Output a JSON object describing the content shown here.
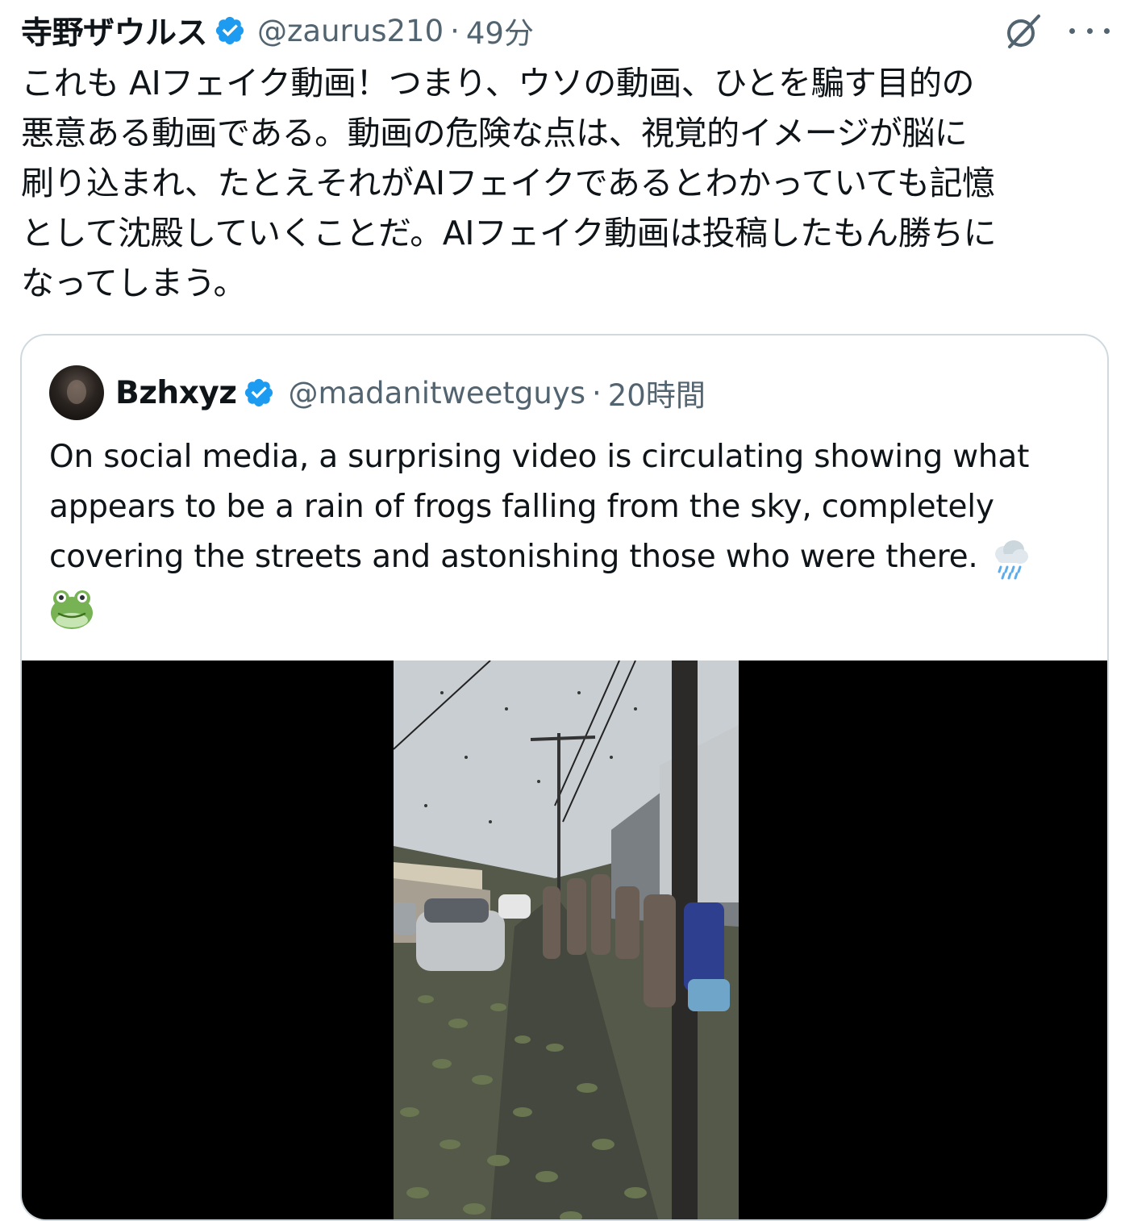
{
  "tweet": {
    "author": {
      "name": "寺野ザウルス",
      "handle": "@zaurus210",
      "separator": "·",
      "time": "49分",
      "verified": true
    },
    "actions": {
      "grok_icon": "grok-slash-circle-icon",
      "more_icon": "more-horizontal-icon"
    },
    "text_lines": [
      "これも AIフェイク動画！つまり、ウソの動画、ひとを騙す目的の",
      "悪意ある動画である。動画の危険な点は、視覚的イメージが脳に",
      "刷り込まれ、たとえそれがAIフェイクであるとわかっていても記憶",
      "として沈殿していくことだ。AIフェイク動画は投稿したもん勝ちに",
      "なってしまう。"
    ]
  },
  "quoted": {
    "author": {
      "name": "Bzhxyz",
      "handle": "@madanitweetguys",
      "separator": "·",
      "time": "20時間",
      "verified": true
    },
    "text_lines": [
      "On social media, a surprising video is circulating showing what",
      "appears to be a rain of frogs falling from the sky, completely",
      "covering the streets and astonishing those who were there."
    ],
    "emojis": [
      "cloud-with-rain-icon",
      "frog-face-icon"
    ],
    "media": {
      "type": "video",
      "background": "#000000"
    }
  },
  "colors": {
    "text": "#0f1419",
    "secondary": "#536471",
    "verified_blue": "#1d9bf0",
    "border": "#cfd9de"
  }
}
